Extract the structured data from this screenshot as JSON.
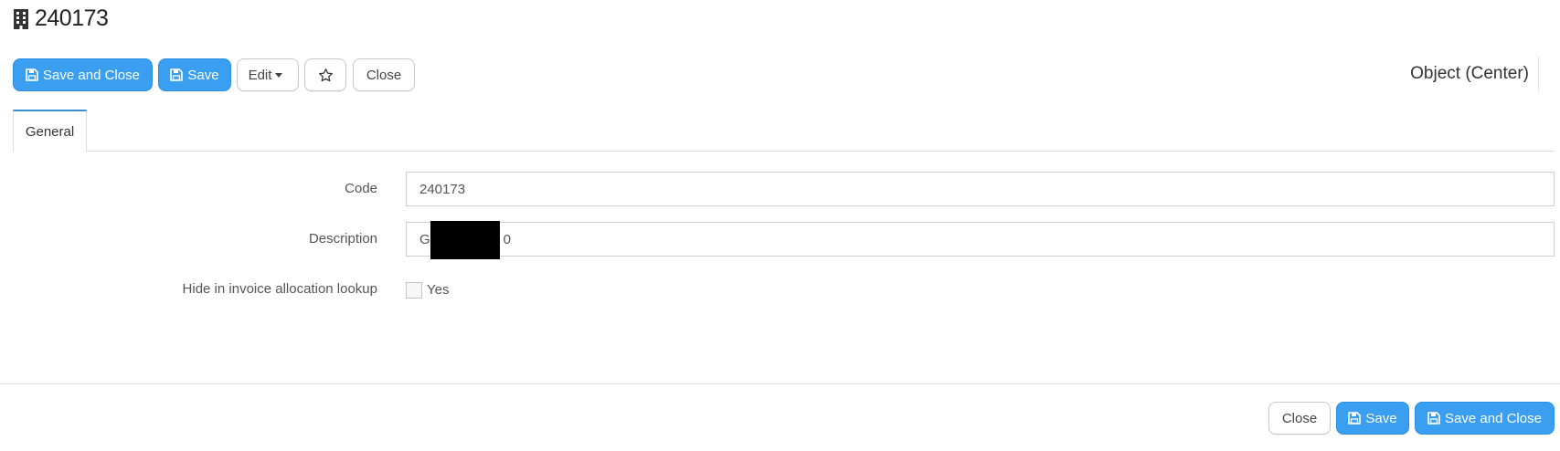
{
  "page": {
    "title": "240173",
    "title_icon": "building-icon"
  },
  "toolbar": {
    "save_close_label": "Save and Close",
    "save_label": "Save",
    "edit_label": "Edit",
    "close_label": "Close",
    "favorite_icon": "star-icon"
  },
  "object_type": "Object (Center)",
  "tabs": [
    {
      "label": "General",
      "active": true
    }
  ],
  "form": {
    "code_label": "Code",
    "code_value": "240173",
    "description_label": "Description",
    "description_value": "G",
    "description_tail": "0",
    "hide_label": "Hide in invoice allocation lookup",
    "hide_option": "Yes",
    "hide_checked": false
  },
  "footer": {
    "close_label": "Close",
    "save_label": "Save",
    "save_close_label": "Save and Close"
  },
  "colors": {
    "primary": "#3a9ff0",
    "tab_accent": "#3a8fd6"
  }
}
